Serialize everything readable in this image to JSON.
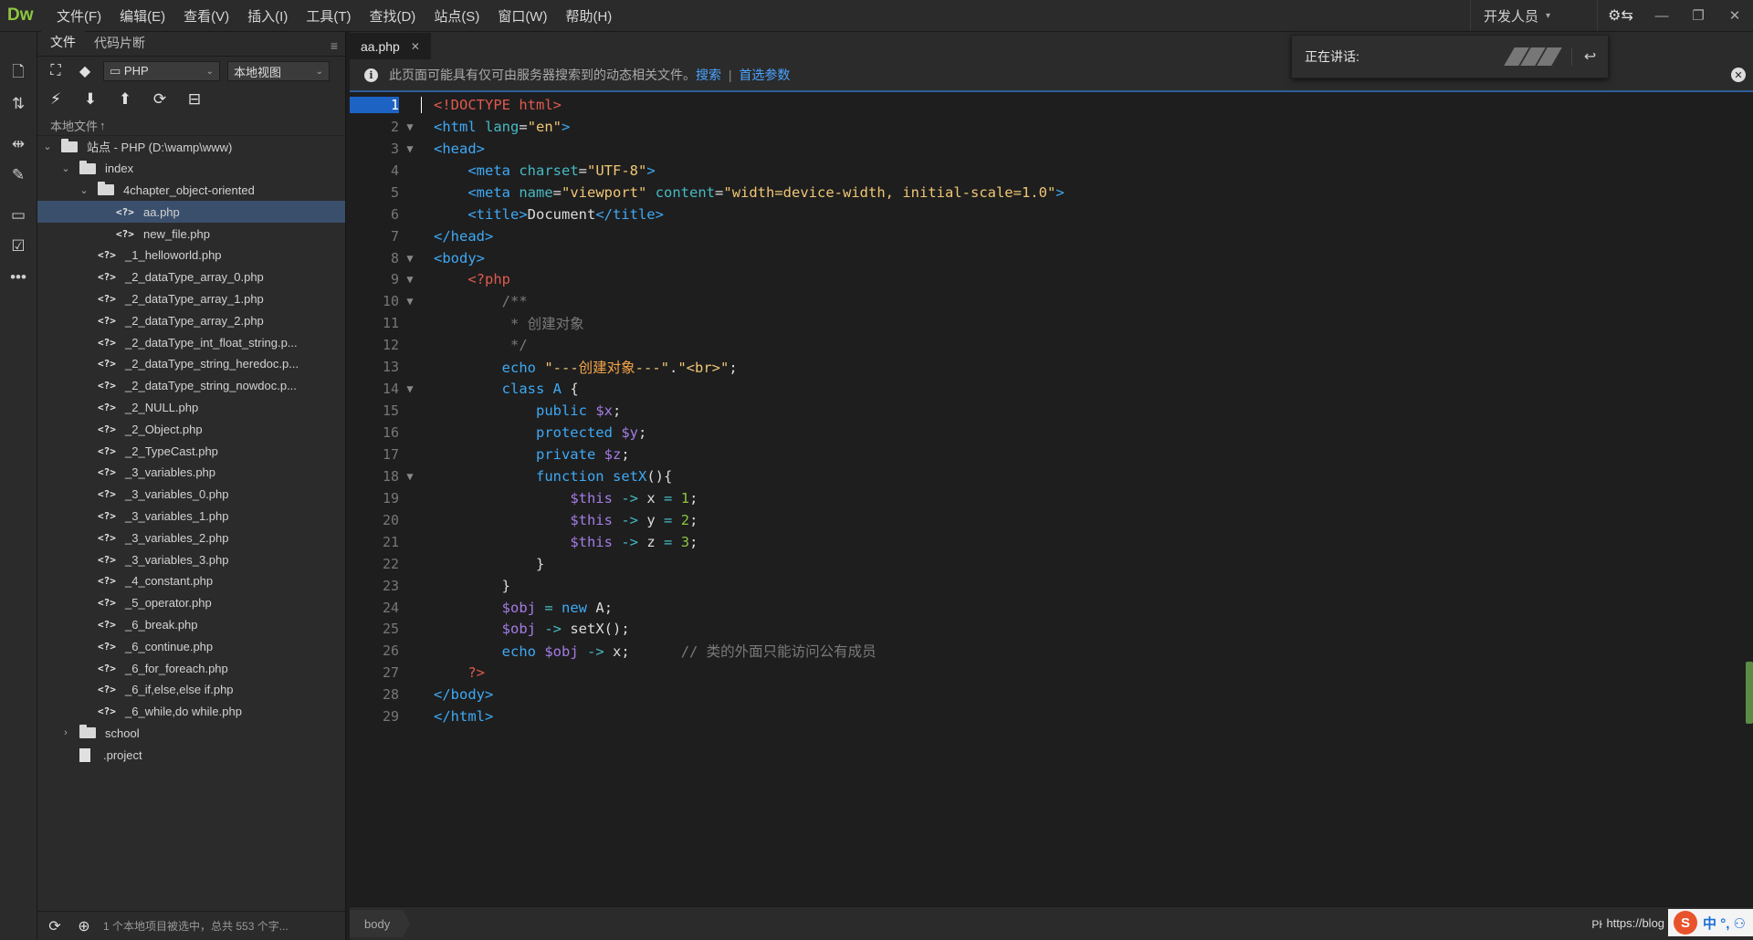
{
  "app": {
    "logo": "Dw",
    "menu": [
      "文件(F)",
      "编辑(E)",
      "查看(V)",
      "插入(I)",
      "工具(T)",
      "查找(D)",
      "站点(S)",
      "窗口(W)",
      "帮助(H)"
    ],
    "workspace": "开发人员",
    "workspace_chevron": "▾",
    "sync_icon": "⚙⇆",
    "window_buttons": [
      "—",
      "❐",
      "✕"
    ]
  },
  "left_toolbar": {
    "icons": [
      "new-file-icon",
      "file-transfer-icon",
      "expand-icon",
      "brush-icon",
      "comment-icon",
      "code-check-icon",
      "more-icon"
    ]
  },
  "files_panel": {
    "tabs": [
      "文件",
      "代码片断"
    ],
    "menu_icon": "≡",
    "site_select": "PHP",
    "view_select": "本地视图",
    "local_files_header": "本地文件",
    "tree": [
      {
        "label": "站点 - PHP (D:\\wamp\\www)",
        "type": "folder",
        "level": 0,
        "arrow": "⌄"
      },
      {
        "label": "index",
        "type": "folder",
        "level": 1,
        "arrow": "⌄"
      },
      {
        "label": "4chapter_object-oriented",
        "type": "folder",
        "level": 2,
        "arrow": "⌄"
      },
      {
        "label": "aa.php",
        "type": "php",
        "level": 3,
        "arrow": "",
        "selected": true
      },
      {
        "label": "new_file.php",
        "type": "php",
        "level": 3,
        "arrow": ""
      },
      {
        "label": "_1_helloworld.php",
        "type": "php",
        "level": 2,
        "arrow": ""
      },
      {
        "label": "_2_dataType_array_0.php",
        "type": "php",
        "level": 2,
        "arrow": ""
      },
      {
        "label": "_2_dataType_array_1.php",
        "type": "php",
        "level": 2,
        "arrow": ""
      },
      {
        "label": "_2_dataType_array_2.php",
        "type": "php",
        "level": 2,
        "arrow": ""
      },
      {
        "label": "_2_dataType_int_float_string.p...",
        "type": "php",
        "level": 2,
        "arrow": ""
      },
      {
        "label": "_2_dataType_string_heredoc.p...",
        "type": "php",
        "level": 2,
        "arrow": ""
      },
      {
        "label": "_2_dataType_string_nowdoc.p...",
        "type": "php",
        "level": 2,
        "arrow": ""
      },
      {
        "label": "_2_NULL.php",
        "type": "php",
        "level": 2,
        "arrow": ""
      },
      {
        "label": "_2_Object.php",
        "type": "php",
        "level": 2,
        "arrow": ""
      },
      {
        "label": "_2_TypeCast.php",
        "type": "php",
        "level": 2,
        "arrow": ""
      },
      {
        "label": "_3_variables.php",
        "type": "php",
        "level": 2,
        "arrow": ""
      },
      {
        "label": "_3_variables_0.php",
        "type": "php",
        "level": 2,
        "arrow": ""
      },
      {
        "label": "_3_variables_1.php",
        "type": "php",
        "level": 2,
        "arrow": ""
      },
      {
        "label": "_3_variables_2.php",
        "type": "php",
        "level": 2,
        "arrow": ""
      },
      {
        "label": "_3_variables_3.php",
        "type": "php",
        "level": 2,
        "arrow": ""
      },
      {
        "label": "_4_constant.php",
        "type": "php",
        "level": 2,
        "arrow": ""
      },
      {
        "label": "_5_operator.php",
        "type": "php",
        "level": 2,
        "arrow": ""
      },
      {
        "label": "_6_break.php",
        "type": "php",
        "level": 2,
        "arrow": ""
      },
      {
        "label": "_6_continue.php",
        "type": "php",
        "level": 2,
        "arrow": ""
      },
      {
        "label": "_6_for_foreach.php",
        "type": "php",
        "level": 2,
        "arrow": ""
      },
      {
        "label": "_6_if,else,else if.php",
        "type": "php",
        "level": 2,
        "arrow": ""
      },
      {
        "label": "_6_while,do while.php",
        "type": "php",
        "level": 2,
        "arrow": ""
      },
      {
        "label": "school",
        "type": "folder",
        "level": 1,
        "arrow": "›"
      },
      {
        "label": ".project",
        "type": "file",
        "level": 1,
        "arrow": ""
      }
    ],
    "status_text": "1 个本地项目被选中，总共 553 个字..."
  },
  "editor": {
    "tab_label": "aa.php",
    "tab_close": "✕",
    "info_text": "此页面可能具有仅可由服务器搜索到的动态相关文件。",
    "info_link_search": "搜索",
    "info_separator": "|",
    "info_link_prefs": "首选参数",
    "current_line": 1,
    "breadcrumb": "body",
    "language": "PHP",
    "ime_url": "https://blog",
    "ime_text": "中 °, ⚇"
  },
  "talk_popup": {
    "label": "正在讲话:"
  },
  "code_lines": [
    {
      "n": 1,
      "fold": "",
      "html": "<span class='doctype'>&lt;!DOCTYPE html&gt;</span>"
    },
    {
      "n": 2,
      "fold": "▼",
      "html": "<span class='tag'>&lt;html</span> <span class='attr'>lang</span>=<span class='str'>\"en\"</span><span class='tag'>&gt;</span>"
    },
    {
      "n": 3,
      "fold": "▼",
      "html": "<span class='tag'>&lt;head&gt;</span>"
    },
    {
      "n": 4,
      "fold": "",
      "html": "    <span class='tag'>&lt;meta</span> <span class='attr'>charset</span>=<span class='str'>\"UTF-8\"</span><span class='tag'>&gt;</span>"
    },
    {
      "n": 5,
      "fold": "",
      "html": "    <span class='tag'>&lt;meta</span> <span class='attr'>name</span>=<span class='str'>\"viewport\"</span> <span class='attr'>content</span>=<span class='str'>\"width=device-width, initial-scale=1.0\"</span><span class='tag'>&gt;</span>"
    },
    {
      "n": 6,
      "fold": "",
      "html": "    <span class='tag'>&lt;title&gt;</span><span class='plain'>Document</span><span class='tag'>&lt;/title&gt;</span>"
    },
    {
      "n": 7,
      "fold": "",
      "html": "<span class='tag'>&lt;/head&gt;</span>"
    },
    {
      "n": 8,
      "fold": "▼",
      "html": "<span class='tag'>&lt;body&gt;</span>"
    },
    {
      "n": 9,
      "fold": "▼",
      "html": "    <span class='phptag'>&lt;?php</span>"
    },
    {
      "n": 10,
      "fold": "▼",
      "html": "        <span class='cmt'>/**</span>"
    },
    {
      "n": 11,
      "fold": "",
      "html": "         <span class='cmt'>* 创建对象</span>"
    },
    {
      "n": 12,
      "fold": "",
      "html": "         <span class='cmt'>*/</span>"
    },
    {
      "n": 13,
      "fold": "",
      "html": "        <span class='kw'>echo</span> <span class='str'>\"---</span><span class='cn'>创建对象</span><span class='str'>---\"</span><span class='plain'>.</span><span class='str'>\"&lt;br&gt;\"</span><span class='plain'>;</span>"
    },
    {
      "n": 14,
      "fold": "▼",
      "html": "        <span class='kw'>class</span> <span class='kw'>A</span> <span class='plain'>{</span>"
    },
    {
      "n": 15,
      "fold": "",
      "html": "            <span class='kw'>public</span> <span class='var'>$x</span><span class='plain'>;</span>"
    },
    {
      "n": 16,
      "fold": "",
      "html": "            <span class='kw'>protected</span> <span class='var'>$y</span><span class='plain'>;</span>"
    },
    {
      "n": 17,
      "fold": "",
      "html": "            <span class='kw'>private</span> <span class='var'>$z</span><span class='plain'>;</span>"
    },
    {
      "n": 18,
      "fold": "▼",
      "html": "            <span class='kw'>function</span> <span class='kw'>setX</span><span class='plain'>(){</span>"
    },
    {
      "n": 19,
      "fold": "",
      "html": "                <span class='var'>$this</span> <span class='op'>-&gt;</span> <span class='plain'>x</span> <span class='op'>=</span> <span class='num'>1</span><span class='plain'>;</span>"
    },
    {
      "n": 20,
      "fold": "",
      "html": "                <span class='var'>$this</span> <span class='op'>-&gt;</span> <span class='plain'>y</span> <span class='op'>=</span> <span class='num'>2</span><span class='plain'>;</span>"
    },
    {
      "n": 21,
      "fold": "",
      "html": "                <span class='var'>$this</span> <span class='op'>-&gt;</span> <span class='plain'>z</span> <span class='op'>=</span> <span class='num'>3</span><span class='plain'>;</span>"
    },
    {
      "n": 22,
      "fold": "",
      "html": "            <span class='plain'>}</span>"
    },
    {
      "n": 23,
      "fold": "",
      "html": "        <span class='plain'>}</span>"
    },
    {
      "n": 24,
      "fold": "",
      "html": "        <span class='var'>$obj</span> <span class='op'>=</span> <span class='kw'>new</span> <span class='plain'>A;</span>"
    },
    {
      "n": 25,
      "fold": "",
      "html": "        <span class='var'>$obj</span> <span class='op'>-&gt;</span> <span class='plain'>setX();</span>"
    },
    {
      "n": 26,
      "fold": "",
      "html": "        <span class='kw'>echo</span> <span class='var'>$obj</span> <span class='op'>-&gt;</span> <span class='plain'>x;</span>      <span class='cmt'>// 类的外面只能访问公有成员</span>"
    },
    {
      "n": 27,
      "fold": "",
      "html": "    <span class='phptag'>?&gt;</span>"
    },
    {
      "n": 28,
      "fold": "",
      "html": "<span class='tag'>&lt;/body&gt;</span>"
    },
    {
      "n": 29,
      "fold": "",
      "html": "<span class='tag'>&lt;/html&gt;</span>"
    }
  ]
}
